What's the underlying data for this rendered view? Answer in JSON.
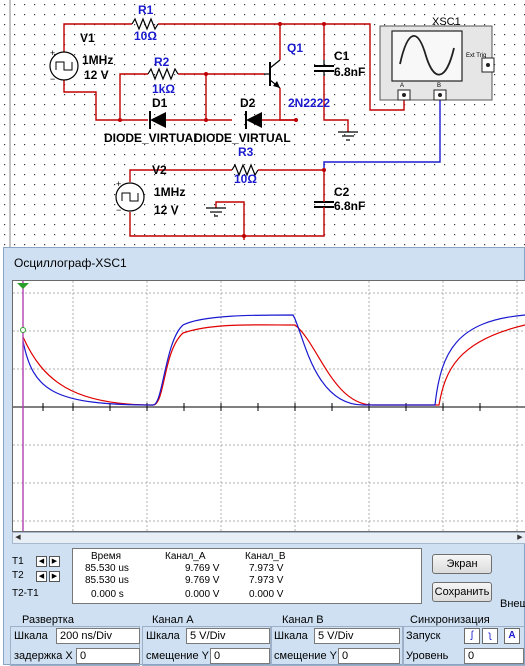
{
  "schematic": {
    "v1": {
      "name": "V1",
      "freq": "1MHz",
      "volt": "12 V"
    },
    "v2": {
      "name": "V2",
      "freq": "1MHz",
      "volt": "12 V"
    },
    "r1": {
      "name": "R1",
      "value": "10Ω"
    },
    "r2": {
      "name": "R2",
      "value": "1kΩ"
    },
    "r3": {
      "name": "R3",
      "value": "10Ω"
    },
    "q1": {
      "name": "Q1",
      "model": "2N2222"
    },
    "c1": {
      "name": "C1",
      "value": "6.8nF"
    },
    "c2": {
      "name": "C2",
      "value": "6.8nF"
    },
    "d1": {
      "name": "D1",
      "model": "DIODE_VIRTUAL"
    },
    "d2": {
      "name": "D2",
      "model": "DIODE_VIRTUAL"
    },
    "xsc": {
      "name": "XSC1",
      "ext_trig": "Ext Trig",
      "ch_a": "A",
      "ch_b": "B"
    }
  },
  "oscilloscope": {
    "title": "Осциллограф-XSC1",
    "cursors": {
      "t1": "T1",
      "t2": "T2",
      "diff": "T2-T1"
    },
    "readout": {
      "headers": {
        "time": "Время",
        "cha": "Канал_A",
        "chb": "Канал_B"
      },
      "rows": [
        {
          "time": "85.530 us",
          "cha": "9.769 V",
          "chb": "7.973 V"
        },
        {
          "time": "85.530 us",
          "cha": "9.769 V",
          "chb": "7.973 V"
        },
        {
          "time": "0.000 s",
          "cha": "0.000 V",
          "chb": "0.000 V"
        }
      ]
    },
    "buttons": {
      "screen": "Экран",
      "save": "Сохранить",
      "ext": "Внеш"
    },
    "timebase": {
      "title": "Развертка",
      "scale_label": "Шкала",
      "scale": "200 ns/Div",
      "pos_label": "задержка X",
      "pos": "0"
    },
    "channel_a": {
      "title": "Канал A",
      "scale_label": "Шкала",
      "scale": "5  V/Div",
      "pos_label": "смещение Y",
      "pos": "0"
    },
    "channel_b": {
      "title": "Канал B",
      "scale_label": "Шкала",
      "scale": "5  V/Div",
      "pos_label": "смещение Y",
      "pos": "0"
    },
    "trigger": {
      "title": "Синхронизация",
      "edge_label": "Запуск",
      "level_label": "Уровень",
      "level": "0",
      "mode_a": "A",
      "icon_rise": "rising-edge-icon",
      "icon_fall": "falling-edge-icon"
    }
  },
  "colors": {
    "channel_a": "#1a1ad0",
    "channel_b": "#e00000",
    "cursor": "#b040b0",
    "window": "#cfe0f2"
  }
}
